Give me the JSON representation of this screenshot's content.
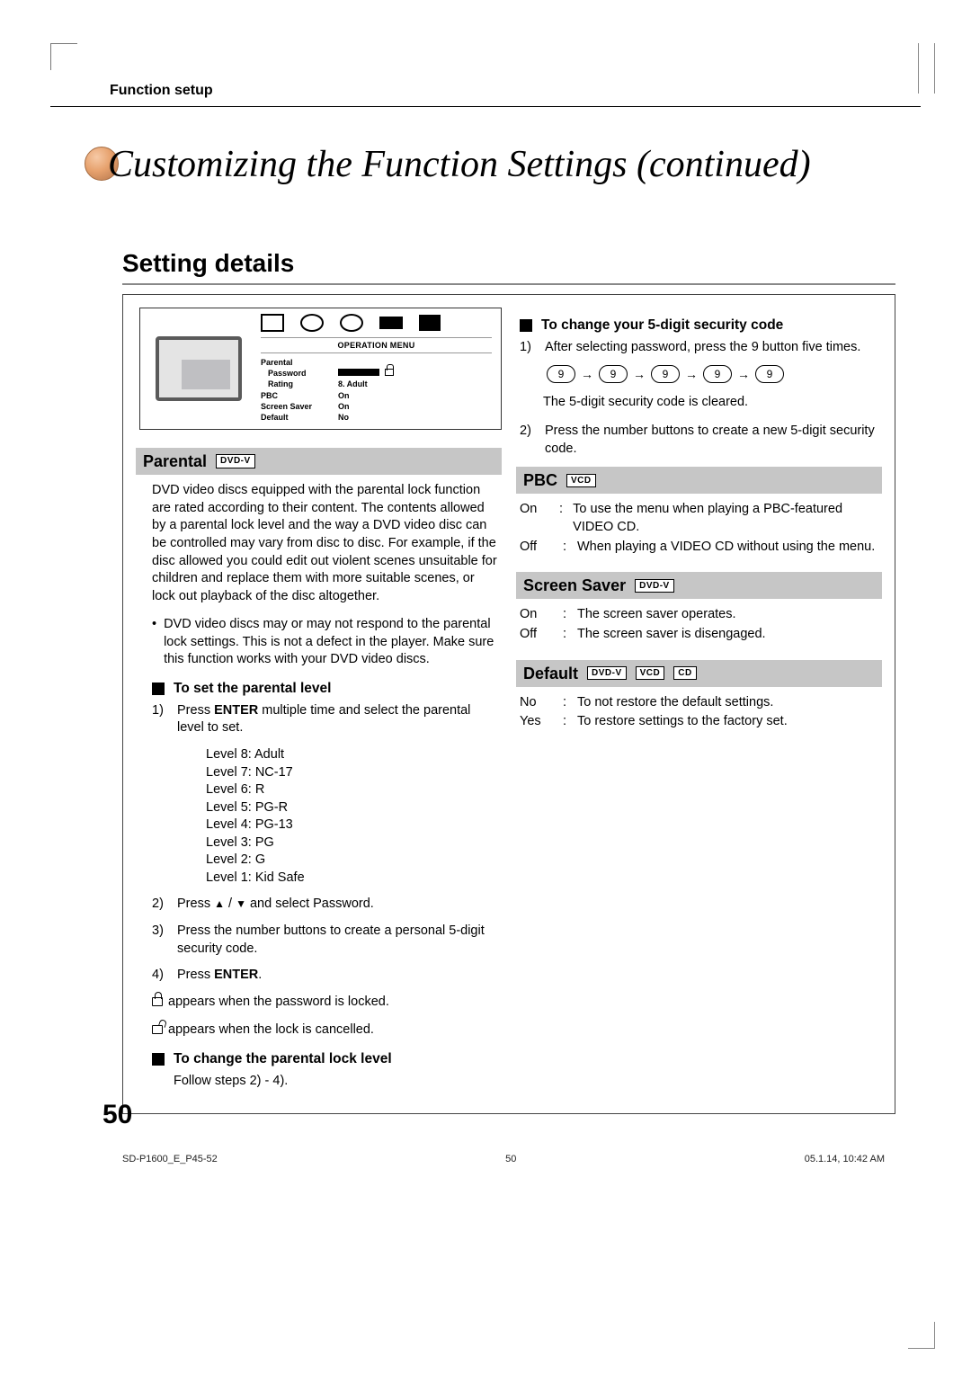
{
  "header_label": "Function setup",
  "title": "Customizing the Function Settings (continued)",
  "subheading": "Setting details",
  "page_number": "50",
  "footer": {
    "left": "SD-P1600_E_P45-52",
    "mid": "50",
    "right": "05.1.14, 10:42 AM"
  },
  "osd": {
    "title": "OPERATION MENU",
    "rows": [
      {
        "label": "Parental",
        "value": ""
      },
      {
        "label": "Password",
        "value": ""
      },
      {
        "label": "Rating",
        "value": "8. Adult"
      },
      {
        "label": "PBC",
        "value": "On"
      },
      {
        "label": "Screen Saver",
        "value": "On"
      },
      {
        "label": "Default",
        "value": "No"
      }
    ]
  },
  "parental": {
    "heading": "Parental",
    "chip": "DVD-V",
    "desc": "DVD video discs equipped with the parental lock function are rated according to their content. The contents allowed by a parental lock level and the way a DVD video disc can be controlled may vary from disc to disc. For example, if the disc allowed you could edit out violent scenes unsuitable for children and replace them with more suitable scenes, or lock out playback of the disc altogether.",
    "note": "DVD video discs may or may not respond to the parental lock settings. This is not a defect in the player. Make sure this function works with your DVD video discs.",
    "set_heading": "To set the parental level",
    "steps": {
      "s1a": "Press ",
      "s1_enter": "ENTER",
      "s1b": " multiple time and select the parental level to set.",
      "s2a": "Press ",
      "s2b": " / ",
      "s2c": " and select Password.",
      "s3": "Press the number buttons to create a personal 5-digit security code.",
      "s4a": "Press ",
      "s4_enter": "ENTER",
      "s4b": "."
    },
    "levels": [
      "Level 8: Adult",
      "Level 7: NC-17",
      "Level 6: R",
      "Level 5: PG-R",
      "Level 4: PG-13",
      "Level 3: PG",
      "Level 2: G",
      "Level 1: Kid Safe"
    ],
    "lock_locked": "appears when the password is locked.",
    "lock_open": "appears when the lock is cancelled.",
    "change_lock_heading": "To change the parental lock level",
    "change_lock_text": "Follow steps 2) - 4)."
  },
  "security": {
    "heading": "To change your 5-digit security code",
    "s1": "After selecting password, press the 9 button five times.",
    "key": "9",
    "cleared": "The 5-digit security code is cleared.",
    "s2": "Press the number buttons to create a new 5-digit security code."
  },
  "pbc": {
    "heading": "PBC",
    "chip": "VCD",
    "on": "To use the menu when playing a PBC-featured VIDEO CD.",
    "off": "When playing a VIDEO CD without using the menu."
  },
  "screensaver": {
    "heading": "Screen Saver",
    "chip": "DVD-V",
    "on": "The screen saver operates.",
    "off": "The screen saver is disengaged."
  },
  "def": {
    "heading": "Default",
    "chips": [
      "DVD-V",
      "VCD",
      "CD"
    ],
    "no": "To not restore the default settings.",
    "yes": "To restore settings to the factory set."
  }
}
